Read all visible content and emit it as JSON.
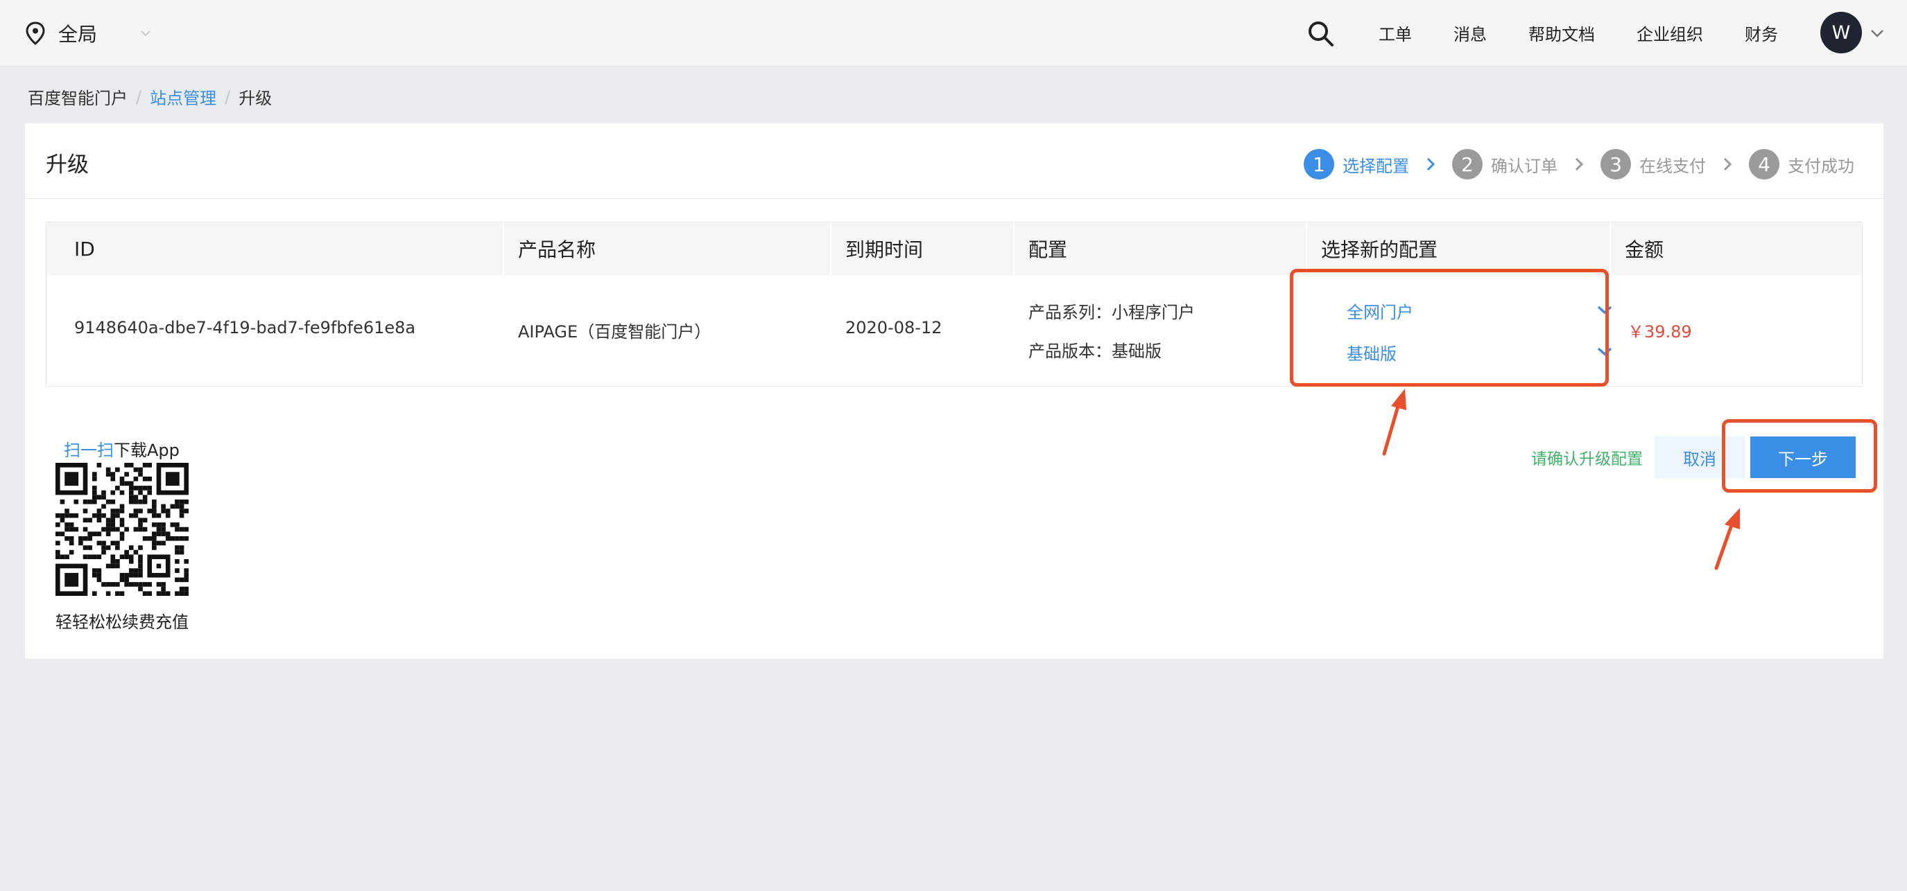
{
  "topbar": {
    "region_label": "全局",
    "nav": [
      "工单",
      "消息",
      "帮助文档",
      "企业组织",
      "财务"
    ],
    "avatar_initial": "W"
  },
  "breadcrumb": {
    "home": "百度智能门户",
    "sep": "/",
    "parent": "站点管理",
    "current": "升级"
  },
  "page": {
    "title": "升级"
  },
  "steps": [
    {
      "num": "1",
      "label": "选择配置",
      "active": true
    },
    {
      "num": "2",
      "label": "确认订单",
      "active": false
    },
    {
      "num": "3",
      "label": "在线支付",
      "active": false
    },
    {
      "num": "4",
      "label": "支付成功",
      "active": false
    }
  ],
  "table": {
    "headers": [
      "ID",
      "产品名称",
      "到期时间",
      "配置",
      "选择新的配置",
      "金额"
    ],
    "row": {
      "id": "9148640a-dbe7-4f19-bad7-fe9fbfe61e8a",
      "product": "AIPAGE（百度智能门户）",
      "expiry": "2020-08-12",
      "config_series": "产品系列：小程序门户",
      "config_version": "产品版本：基础版",
      "new_series": "全网门户",
      "new_version": "基础版",
      "amount": "￥39.89"
    }
  },
  "qr": {
    "scan_text": "扫一扫",
    "download_text": "下载App",
    "subtitle": "轻轻松松续费充值"
  },
  "actions": {
    "hint": "请确认升级配置",
    "cancel": "取消",
    "next": "下一步"
  },
  "colors": {
    "accent": "#3a8ee6",
    "price": "#e24b3b",
    "hint": "#3db36a",
    "annotation": "#e8502c"
  },
  "icons": {
    "region": "map-pin-icon",
    "search": "search-icon",
    "dropdown": "chevron-down-icon",
    "step_separator": "chevron-right-icon",
    "qr": "qr-code-icon"
  }
}
